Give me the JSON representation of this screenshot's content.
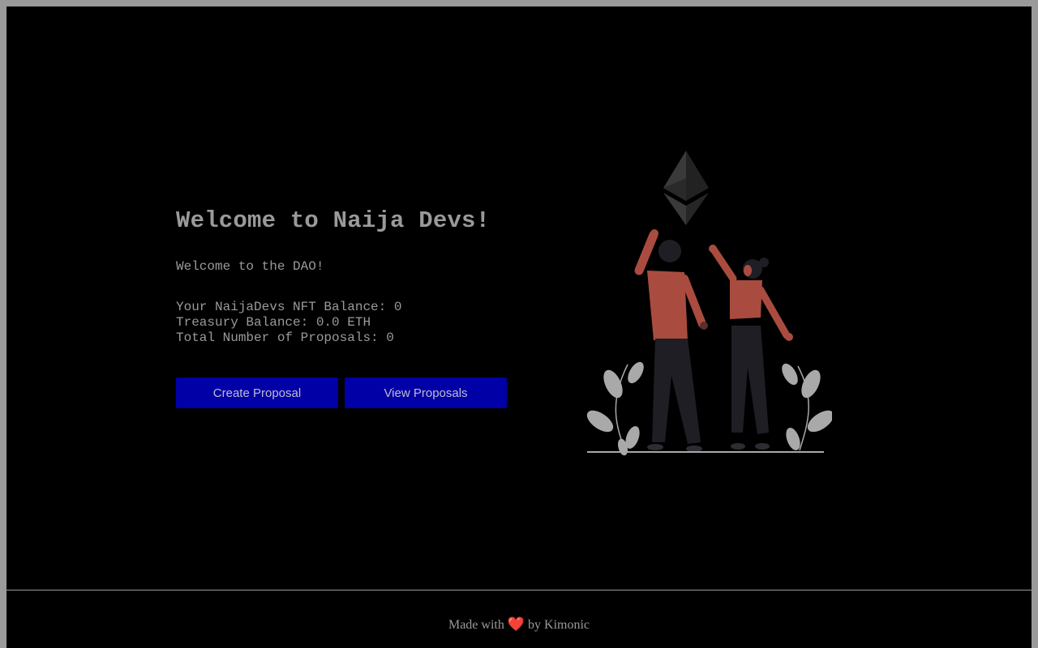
{
  "hero": {
    "title": "Welcome to Naija Devs!",
    "subtitle": "Welcome to the DAO!"
  },
  "stats": {
    "nft_balance": "Your NaijaDevs NFT Balance: 0",
    "treasury_balance": "Treasury Balance: 0.0 ETH",
    "total_proposals": "Total Number of Proposals: 0"
  },
  "actions": {
    "create_label": "Create Proposal",
    "view_label": "View Proposals"
  },
  "illustration": {
    "icon": "ethereum-logo-icon",
    "people": "two-people-cheering-illustration"
  },
  "footer": {
    "made_with": "Made with",
    "heart": "❤️",
    "by": "by Kimonic"
  },
  "colors": {
    "background": "#000000",
    "text": "#9a9a9a",
    "button": "#0000a6",
    "accent": "#a94c3f",
    "heart": "#b3262a"
  }
}
